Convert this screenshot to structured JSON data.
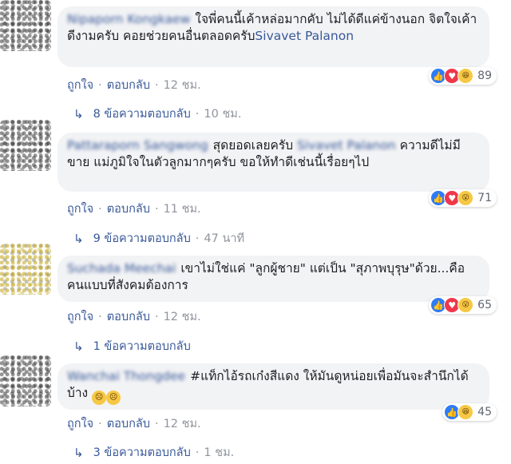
{
  "comments": [
    {
      "author": "Nipaporn Kongkaew",
      "text": "ใจพี่คนนี้เค้าหล่อมากคับ ไม่ได้ดีแค่ข้างนอก จิตใจเค้าดีงามครับ คอยช่วยคนอื่นตลอดครับ",
      "mention": "Sivavet Palanon",
      "reactions": [
        "like",
        "love",
        "haha"
      ],
      "reaction_count": "89",
      "like_label": "ถูกใจ",
      "reply_label": "ตอบกลับ",
      "time": "12 ชม.",
      "replies_text": "8 ข้อความตอบกลับ",
      "replies_time": "10 ชม."
    },
    {
      "author": "Pattaraporn Sangwong",
      "text_1": "สุดยอดเลยครับ",
      "mention_1": "Sivavet Palanon",
      "text_2": "ความดีไม่มีขาย แม่ภูมิใจในตัวลูกมากๆครับ ขอให้ทำดีเช่นนี้เรื่อยๆไป",
      "reactions": [
        "like",
        "love",
        "wow"
      ],
      "reaction_count": "71",
      "like_label": "ถูกใจ",
      "reply_label": "ตอบกลับ",
      "time": "11 ชม.",
      "replies_text": "9 ข้อความตอบกลับ",
      "replies_time": "47 นาที"
    },
    {
      "author": "Suchada Meechai",
      "text": "เขาไม่ใช่แค่ \"ลูกผู้ชาย\" แต่เป็น \"สุภาพบุรุษ\"ด้วย...คือ คนแบบที่สังคมต้องการ",
      "reactions": [
        "like",
        "love",
        "wow"
      ],
      "reaction_count": "65",
      "like_label": "ถูกใจ",
      "reply_label": "ตอบกลับ",
      "time": "12 ชม.",
      "replies_text": "1 ข้อความตอบกลับ"
    },
    {
      "author": "Wanchai Thongdee",
      "text": "#แท็กไอ้รถเก๋งสีแดง ให้มันดูหน่อยเพื่อมันจะสำนึกได้บ้าง",
      "reactions": [
        "like",
        "haha"
      ],
      "reaction_count": "45",
      "like_label": "ถูกใจ",
      "reply_label": "ตอบกลับ",
      "time": "12 ชม.",
      "replies_text": "3 ข้อความตอบกลับ",
      "replies_time": "1 ชม."
    }
  ],
  "colors": {
    "bubble": "#f2f3f5",
    "link": "#385898",
    "meta": "#90949c",
    "like": "#2e7bf6",
    "love": "#f0374b",
    "haha": "#f7c844"
  }
}
